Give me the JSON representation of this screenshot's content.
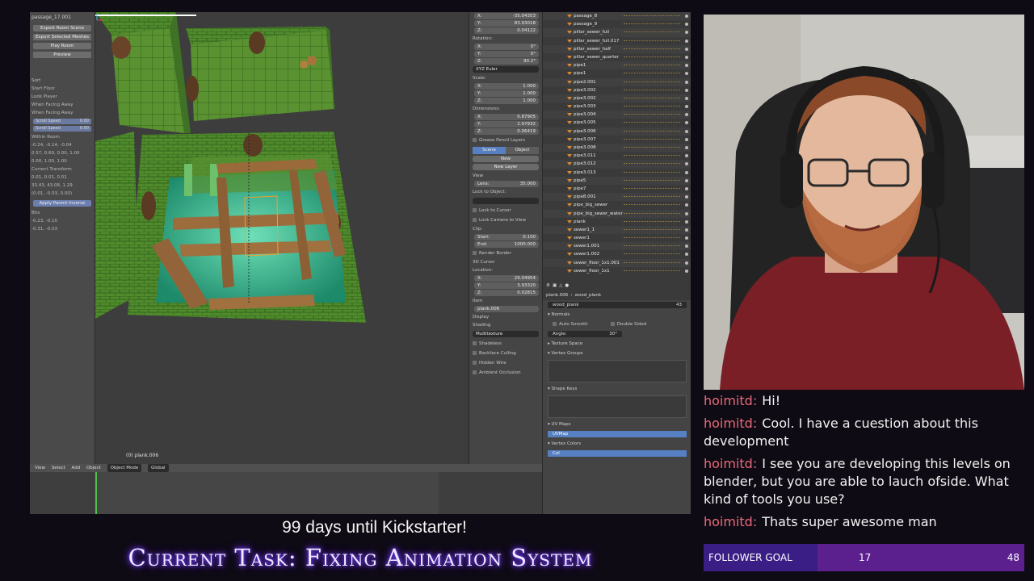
{
  "blender": {
    "tool_shelf": {
      "header": "passage_17.001",
      "buttons": [
        "Export Room Scene",
        "Export Selected Meshes",
        "Play Room",
        "Preview"
      ],
      "lines": [
        "Sort",
        "Start Floor",
        "Look Player",
        "When Facing Away",
        "When Facing Away"
      ],
      "fields": [
        {
          "label": "Scroll Speed",
          "value": "0.00"
        },
        {
          "label": "Scroll Speed",
          "value": "0.00"
        }
      ],
      "sub_lines": [
        "Within Room",
        "-0.24, -0.14, -0.04",
        "0.57, 0.60, 0.00, 1.00",
        "0.00, 1.00, 1.00",
        "Current Transform",
        "0.01, 0.01, 0.01",
        "33.43, 43.08, 1.29",
        "(0.01, -0.03, 0.00)",
        "Apply Parent Inverse",
        "Bits",
        "-0.23, -0.10",
        "-0.31, -0.03"
      ]
    },
    "viewport": {
      "info": "(0) plank.006"
    },
    "properties": {
      "location": [
        {
          "axis": "X:",
          "value": "-35.04353"
        },
        {
          "axis": "Y:",
          "value": "83.93018"
        },
        {
          "axis": "Z:",
          "value": "0.04122"
        }
      ],
      "rotation_label": "Rotation:",
      "rotation": [
        {
          "axis": "X:",
          "value": "0°"
        },
        {
          "axis": "Y:",
          "value": "0°"
        },
        {
          "axis": "Z:",
          "value": "90.2°"
        }
      ],
      "rotation_mode": "XYZ Euler",
      "scale_label": "Scale:",
      "scale": [
        {
          "axis": "X:",
          "value": "1.000"
        },
        {
          "axis": "Y:",
          "value": "1.000"
        },
        {
          "axis": "Z:",
          "value": "1.000"
        }
      ],
      "dimensions_label": "Dimensions:",
      "dimensions": [
        {
          "axis": "X:",
          "value": "0.87905"
        },
        {
          "axis": "Y:",
          "value": "2.97932"
        },
        {
          "axis": "Z:",
          "value": "0.06419"
        }
      ],
      "grease_pencil": "Grease Pencil Layers",
      "tabs": [
        "Scene",
        "Object"
      ],
      "new_label": "New",
      "new_layer": "New Layer",
      "view_label": "View",
      "lens": {
        "label": "Lens:",
        "value": "35.000"
      },
      "lock_to_object": "Lock to Object:",
      "lock_to_cursor": "Lock to Cursor",
      "lock_camera": "Lock Camera to View",
      "clip_label": "Clip:",
      "clip_start": {
        "label": "Start:",
        "value": "0.100"
      },
      "clip_end": {
        "label": "End:",
        "value": "1000.000"
      },
      "render_border": "Render Border",
      "cursor_label": "3D Cursor",
      "cursor_location_label": "Location:",
      "cursor_location": [
        {
          "axis": "X:",
          "value": "29.04954"
        },
        {
          "axis": "Y:",
          "value": "3.93320"
        },
        {
          "axis": "Z:",
          "value": "0.02815"
        }
      ],
      "item_label": "Item",
      "item_name": "plank.006",
      "display_label": "Display",
      "shading_label": "Shading",
      "shading_mode": "Multitexture",
      "shading_checks": [
        "Shadeless",
        "Backface Culling",
        "Hidden Wire",
        "Ambient Occlusion"
      ]
    },
    "outliner": {
      "items": [
        "passage_8",
        "passage_9",
        "pillar_sewer_full",
        "pillar_sewer_full.017",
        "pillar_sewer_half",
        "pillar_sewer_quarter",
        "pipe1",
        "pipe1",
        "pipe2.001",
        "pipe3.002",
        "pipe3.002",
        "pipe3.003",
        "pipe3.004",
        "pipe3.005",
        "pipe3.006",
        "pipe3.007",
        "pipe3.008",
        "pipe3.011",
        "pipe3.012",
        "pipe3.013",
        "pipe5",
        "pipe7",
        "pipe8.001",
        "pipe_big_sewer",
        "pipe_big_sewer_water",
        "plank",
        "sewer1_1",
        "sewer1",
        "sewer1.001",
        "sewer1.002",
        "sewer_floor_1x1.001",
        "sewer_floor_1x1"
      ]
    },
    "material_panel": {
      "object": "plank.006",
      "mesh": "wood_plank",
      "data_name": "wood_plank",
      "users": "43",
      "sections": [
        "Normals",
        "Texture Space",
        "Vertex Groups",
        "Shape Keys",
        "UV Maps",
        "Vertex Colors"
      ],
      "auto_smooth": "Auto Smooth",
      "double_sided": "Double Sided",
      "angle": {
        "label": "Angle:",
        "value": "30°"
      },
      "uv_map": "UVMap",
      "vertex_color": "Col"
    },
    "header": {
      "menus": [
        "View",
        "Select",
        "Add",
        "Object"
      ],
      "mode": "Object Mode",
      "orientation": "Global"
    }
  },
  "chat": {
    "messages": [
      {
        "user": "hoimitd",
        "text": "Hi!"
      },
      {
        "user": "hoimitd",
        "text": "Cool. I have a cuestion about this development"
      },
      {
        "user": "hoimitd",
        "text": "I see you are developing this levels on blender, but you are able to lauch ofside. What kind of tools you use?"
      },
      {
        "user": "hoimitd",
        "text": "Thats super awesome man"
      }
    ]
  },
  "follower_goal": {
    "label": "FOLLOWER GOAL",
    "current": "17",
    "target": "48",
    "progress_fraction": 0.354
  },
  "overlay": {
    "countdown": "99 days until Kickstarter!",
    "task": "Current Task: Fixing Animation System"
  },
  "colors": {
    "chat_user": "#e86a7a",
    "goal_bar": "#5b1f8e",
    "goal_fill": "#3a1e86",
    "task_glow": "#7a45ff",
    "blender_selected": "#5680c2"
  }
}
